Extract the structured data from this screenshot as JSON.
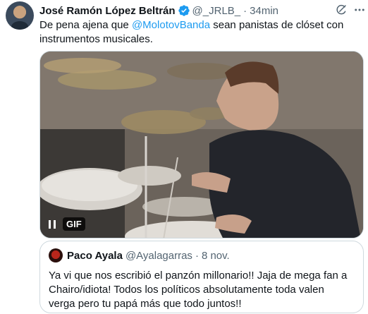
{
  "author": {
    "name": "José Ramón López Beltrán",
    "handle": "@_JRLB_",
    "separator": "·",
    "time": "34min"
  },
  "tweet": {
    "text_before": "De pena ajena que ",
    "mention": "@MolotovBanda",
    "text_after": " sean panistas de clóset con instrumentos musicales."
  },
  "media": {
    "badge": "GIF",
    "icons": [
      "pause-icon"
    ]
  },
  "quoted": {
    "name": "Paco Ayala",
    "handle": "@Ayalagarras",
    "separator": "·",
    "time": "8 nov.",
    "text": "Ya vi que nos escribió el panzón millonario!! Jaja de mega fan a Chairo/idiota! Todos los políticos absolutamente toda valen verga pero tu papá más que todo juntos!!"
  },
  "icons": {
    "verified": "verified-badge-icon",
    "grok": "grok-icon",
    "more": "more-icon"
  },
  "colors": {
    "link": "#1d9bf0",
    "verified": "#1d9bf0",
    "secondary_text": "#536471",
    "border": "#cfd9de"
  }
}
